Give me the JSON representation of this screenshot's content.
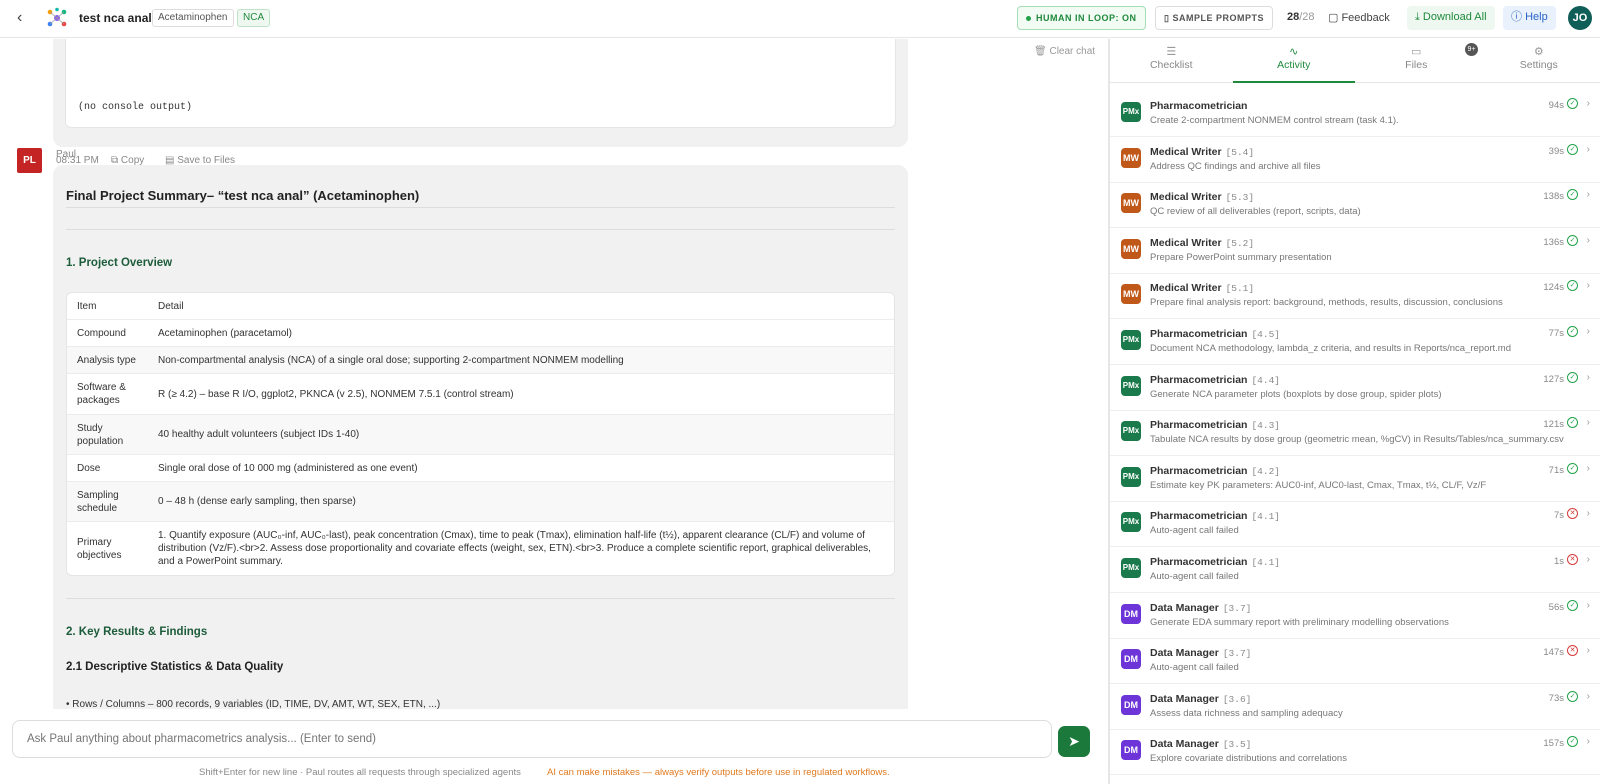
{
  "header": {
    "back_icon": "chevron-left-icon",
    "title": "test nca anal",
    "tags": [
      "Acetaminophen",
      "NCA"
    ],
    "human_in_loop": "HUMAN IN LOOP: ON",
    "sample_prompts": "SAMPLE PROMPTS",
    "count_done": "28",
    "count_total": "/28",
    "feedback": "Feedback",
    "download_all": "Download All",
    "help": "Help",
    "user_initials": "JO",
    "accent": "#1f8a3c"
  },
  "chat": {
    "clear_chat": "Clear chat",
    "console_output": "(no console output)",
    "meta": {
      "time": "08:31 PM",
      "copy": "Copy",
      "save": "Save to Files"
    },
    "sender_initials": "PL",
    "sender_name": "Paul",
    "summary_title": "Final Project Summary– “test nca anal” (Acetaminophen)",
    "section1": "1. Project Overview",
    "table": {
      "headers": [
        "Item",
        "Detail"
      ],
      "rows": [
        {
          "item": "Compound",
          "detail": "Acetaminophen (paracetamol)"
        },
        {
          "item": "Analysis type",
          "detail": "Non-compartmental analysis (NCA) of a single oral dose; supporting 2-compartment NONMEM modelling"
        },
        {
          "item": "Software & packages",
          "detail": "R (≥ 4.2) – base R I/O, ggplot2, PKNCA (v 2.5), NONMEM 7.5.1 (control stream)"
        },
        {
          "item": "Study population",
          "detail": "40 healthy adult volunteers (subject IDs 1-40)"
        },
        {
          "item": "Dose",
          "detail": "Single oral dose of 10 000 mg (administered as one event)"
        },
        {
          "item": "Sampling schedule",
          "detail": "0 – 48 h (dense early sampling, then sparse)"
        },
        {
          "item": "Primary objectives",
          "detail": "1. Quantify exposure (AUC₀-inf, AUC₀-last), peak concentration (Cmax), time to peak (Tmax), elimination half-life (t½), apparent clearance (CL/F) and volume of distribution (Vz/F).<br>2. Assess dose proportionality and covariate effects (weight, sex, ETN).<br>3. Produce a complete scientific report, graphical deliverables, and a PowerPoint summary."
        }
      ]
    },
    "section2": "2. Key Results & Findings",
    "section21": "2.1 Descriptive Statistics & Data Quality",
    "partial_line": "• Rows / Columns – 800 records, 9 variables (ID, TIME, DV, AMT, WT, SEX, ETN, ...)"
  },
  "input": {
    "placeholder": "Ask Paul anything about pharmacometrics analysis... (Enter to send)",
    "footer_hint": "Shift+Enter for new line · Paul routes all requests through specialized agents",
    "footer_warning": "AI can make mistakes — always verify outputs before use in regulated workflows."
  },
  "panel": {
    "tabs": [
      {
        "label": "Checklist",
        "icon": "checklist-icon"
      },
      {
        "label": "Activity",
        "icon": "activity-icon"
      },
      {
        "label": "Files",
        "icon": "folder-icon"
      },
      {
        "label": "Settings",
        "icon": "gear-icon"
      }
    ],
    "files_badge": "9+",
    "activities": [
      {
        "initials": "PMx",
        "role": "Pharmacometrician",
        "task": "",
        "desc": "Create 2-compartment NONMEM control stream (task 4.1).",
        "time": "94s",
        "status": "ok",
        "color": "#1a7a4c"
      },
      {
        "initials": "MW",
        "role": "Medical Writer",
        "task": "[5.4]",
        "desc": "Address QC findings and archive all files",
        "time": "39s",
        "status": "ok",
        "color": "#c0581a"
      },
      {
        "initials": "MW",
        "role": "Medical Writer",
        "task": "[5.3]",
        "desc": "QC review of all deliverables (report, scripts, data)",
        "time": "138s",
        "status": "ok",
        "color": "#c0581a"
      },
      {
        "initials": "MW",
        "role": "Medical Writer",
        "task": "[5.2]",
        "desc": "Prepare PowerPoint summary presentation",
        "time": "136s",
        "status": "ok",
        "color": "#c0581a"
      },
      {
        "initials": "MW",
        "role": "Medical Writer",
        "task": "[5.1]",
        "desc": "Prepare final analysis report: background, methods, results, discussion, conclusions",
        "time": "124s",
        "status": "ok",
        "color": "#c0581a"
      },
      {
        "initials": "PMx",
        "role": "Pharmacometrician",
        "task": "[4.5]",
        "desc": "Document NCA methodology, lambda_z criteria, and results in Reports/nca_report.md",
        "time": "77s",
        "status": "ok",
        "color": "#1a7a4c"
      },
      {
        "initials": "PMx",
        "role": "Pharmacometrician",
        "task": "[4.4]",
        "desc": "Generate NCA parameter plots (boxplots by dose group, spider plots)",
        "time": "127s",
        "status": "ok",
        "color": "#1a7a4c"
      },
      {
        "initials": "PMx",
        "role": "Pharmacometrician",
        "task": "[4.3]",
        "desc": "Tabulate NCA results by dose group (geometric mean, %gCV) in Results/Tables/nca_summary.csv",
        "time": "121s",
        "status": "ok",
        "color": "#1a7a4c"
      },
      {
        "initials": "PMx",
        "role": "Pharmacometrician",
        "task": "[4.2]",
        "desc": "Estimate key PK parameters: AUC0-inf, AUC0-last, Cmax, Tmax, t½, CL/F, Vz/F",
        "time": "71s",
        "status": "ok",
        "color": "#1a7a4c"
      },
      {
        "initials": "PMx",
        "role": "Pharmacometrician",
        "task": "[4.1]",
        "desc": "Auto-agent call failed",
        "time": "7s",
        "status": "err",
        "color": "#1a7a4c"
      },
      {
        "initials": "PMx",
        "role": "Pharmacometrician",
        "task": "[4.1]",
        "desc": "Auto-agent call failed",
        "time": "1s",
        "status": "err",
        "color": "#1a7a4c"
      },
      {
        "initials": "DM",
        "role": "Data Manager",
        "task": "[3.7]",
        "desc": "Generate EDA summary report with preliminary modelling observations",
        "time": "56s",
        "status": "ok",
        "color": "#6d35d8"
      },
      {
        "initials": "DM",
        "role": "Data Manager",
        "task": "[3.7]",
        "desc": "Auto-agent call failed",
        "time": "147s",
        "status": "err",
        "color": "#6d35d8"
      },
      {
        "initials": "DM",
        "role": "Data Manager",
        "task": "[3.6]",
        "desc": "Assess data richness and sampling adequacy",
        "time": "73s",
        "status": "ok",
        "color": "#6d35d8"
      },
      {
        "initials": "DM",
        "role": "Data Manager",
        "task": "[3.5]",
        "desc": "Explore covariate distributions and correlations",
        "time": "157s",
        "status": "ok",
        "color": "#6d35d8"
      }
    ]
  }
}
